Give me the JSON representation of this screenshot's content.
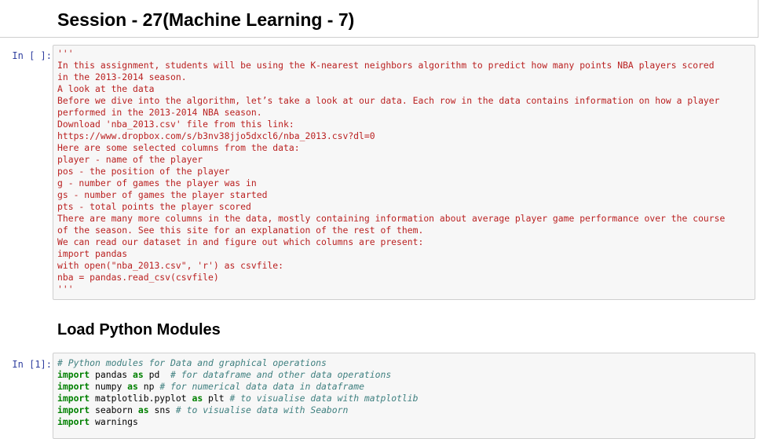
{
  "title_cell": {
    "text": "Session - 27(Machine Learning - 7)"
  },
  "cell1": {
    "prompt": "In [ ]:",
    "lines": [
      "'''",
      "In this assignment, students will be using the K-nearest neighbors algorithm to predict how many points NBA players scored",
      "in the 2013-2014 season.",
      "A look at the data",
      "Before we dive into the algorithm, let’s take a look at our data. Each row in the data contains information on how a player",
      "performed in the 2013-2014 NBA season.",
      "Download 'nba_2013.csv' file from this link:",
      "https://www.dropbox.com/s/b3nv38jjo5dxcl6/nba_2013.csv?dl=0",
      "Here are some selected columns from the data:",
      "player - name of the player",
      "pos - the position of the player",
      "g - number of games the player was in",
      "gs - number of games the player started",
      "pts - total points the player scored",
      "There are many more columns in the data, mostly containing information about average player game performance over the course",
      "of the season. See this site for an explanation of the rest of them.",
      "We can read our dataset in and figure out which columns are present:",
      "import pandas",
      "with open(\"nba_2013.csv\", 'r') as csvfile:",
      "nba = pandas.read_csv(csvfile)",
      "'''"
    ]
  },
  "heading_cell": {
    "text": "Load Python Modules"
  },
  "cell2": {
    "prompt": "In [1]:",
    "comment_line": "# Python modules for Data and graphical operations",
    "imports": [
      {
        "kw": "import",
        "module": " pandas ",
        "as": "as",
        "alias": " pd  ",
        "comment": "# for dataframe and other data operations"
      },
      {
        "kw": "import",
        "module": " numpy ",
        "as": "as",
        "alias": " np ",
        "comment": "# for numerical data data in dataframe"
      },
      {
        "kw": "import",
        "module": " matplotlib.pyplot ",
        "as": "as",
        "alias": " plt ",
        "comment": "# to visualise data with matplotlib"
      },
      {
        "kw": "import",
        "module": " seaborn ",
        "as": "as",
        "alias": " sns ",
        "comment": "# to visualise data with Seaborn"
      },
      {
        "kw": "import",
        "module": " warnings",
        "as": "",
        "alias": "",
        "comment": ""
      }
    ]
  }
}
